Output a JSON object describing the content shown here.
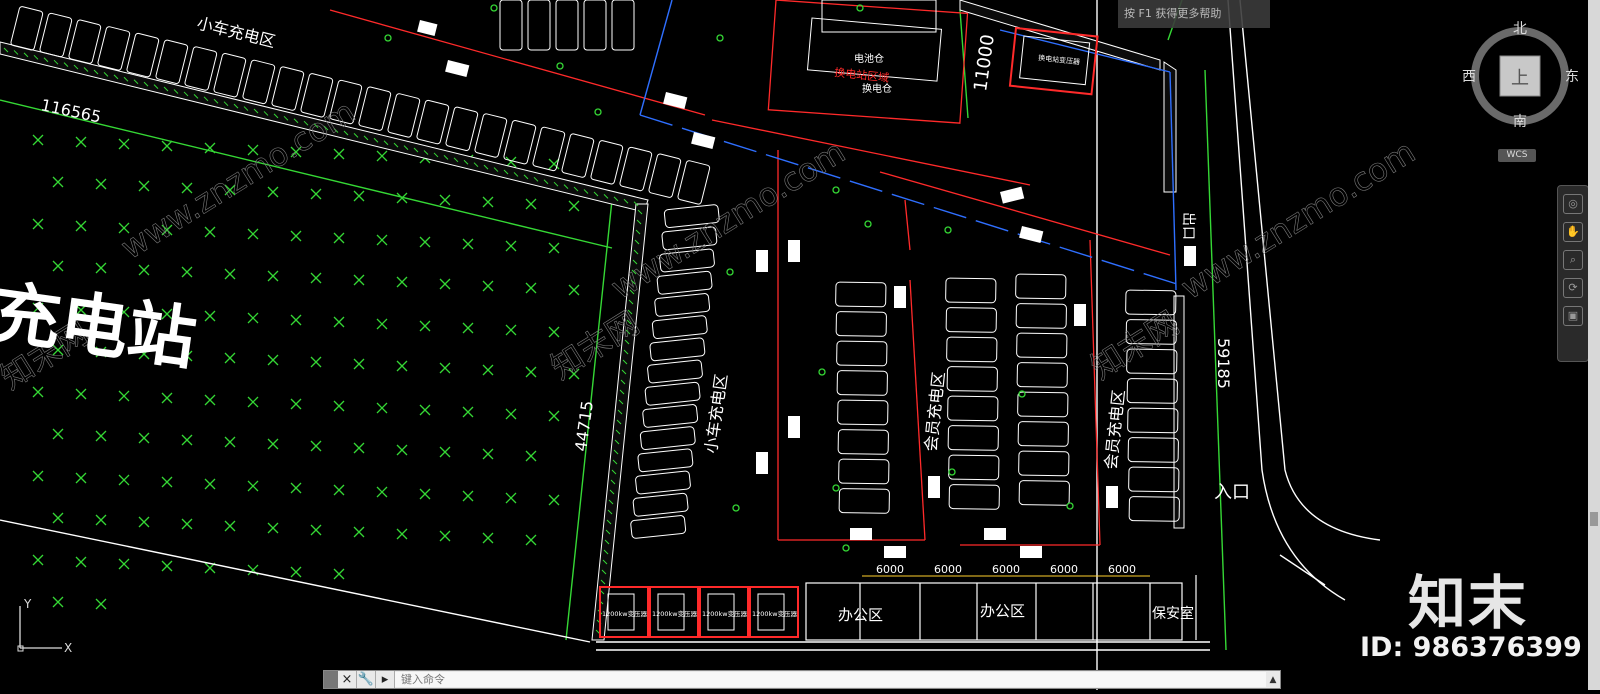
{
  "canvas": {
    "labels": {
      "top_area": "小车充电区",
      "big_title": "充电站",
      "left_zone": "小车充电区",
      "member_zone_1": "会员充电区",
      "member_zone_2": "会员充电区",
      "exit": "出口",
      "entrance": "入口",
      "office_1": "办公区",
      "office_2": "办公区",
      "security": "保安室",
      "swap_area": "换电站区域",
      "battery_room": "电池仓",
      "swap_room": "换电仓",
      "transformer_room": "换电站变压器",
      "transformers": [
        "1200kw变压器",
        "1200kw变压器",
        "1200kw变压器",
        "1200kw变压器"
      ]
    },
    "dimensions": {
      "d_top": "116565",
      "d_left": "44715",
      "d_right": "59185",
      "d_swap": "11000",
      "bays": [
        "6000",
        "6000",
        "6000",
        "6000",
        "6000"
      ]
    },
    "colors": {
      "background": "#000000",
      "wall": "#ffffff",
      "red_line": "#ff2a2a",
      "green_line": "#35d835",
      "blue_line": "#2f6fff",
      "watermark": "#9a9a9a"
    },
    "watermarks": [
      "www.znzmo.com",
      "知末网"
    ]
  },
  "ui": {
    "help_tip": "按 F1 获得更多帮助",
    "viewcube": {
      "north": "北",
      "south": "南",
      "east": "东",
      "west": "西",
      "top": "上"
    },
    "wcs_label": "WCS",
    "command": {
      "placeholder": "键入命令",
      "close_icon": "×",
      "settings_icon": "🔧"
    },
    "ucs": {
      "x": "X",
      "y": "Y"
    }
  },
  "brand": {
    "logo": "知末",
    "id_text": "ID: 986376399"
  }
}
